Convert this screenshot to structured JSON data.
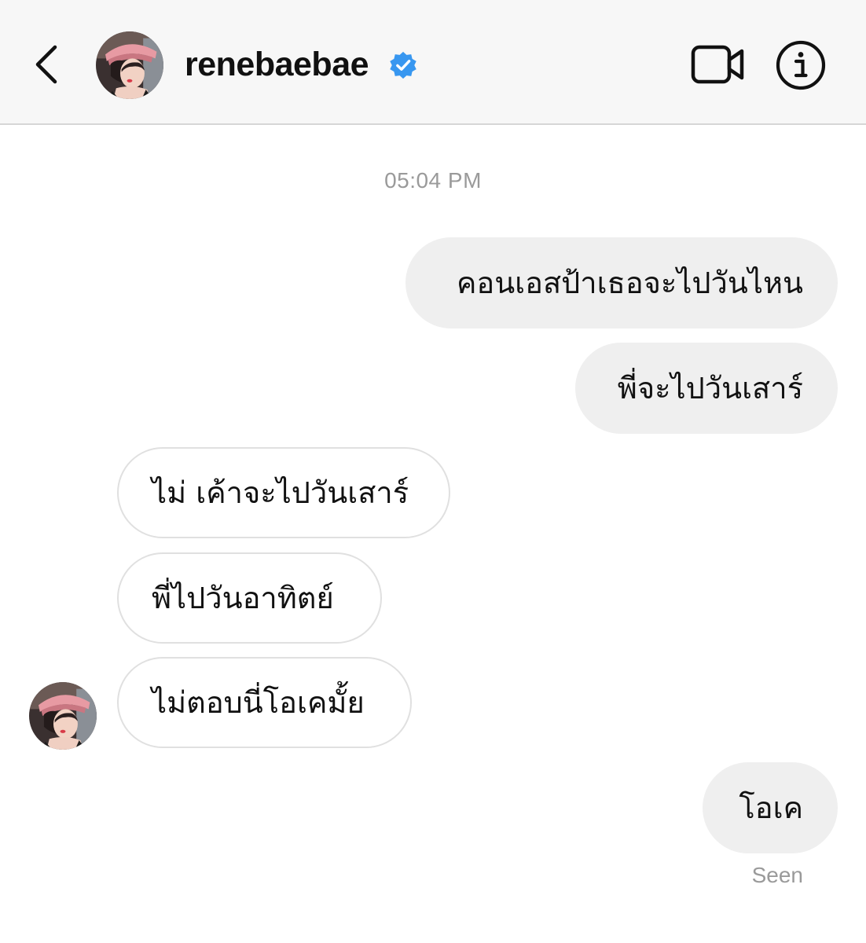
{
  "header": {
    "username": "renebaebae",
    "verified_color": "#3897f0",
    "icons": {
      "back": "chevron-left-icon",
      "verified": "verified-badge-icon",
      "video": "video-camera-icon",
      "info": "info-icon"
    }
  },
  "conversation": {
    "timestamp": "05:04 PM",
    "messages": [
      {
        "direction": "outgoing",
        "text": "คอนเอสป้าเธอจะไปวันไหน"
      },
      {
        "direction": "outgoing",
        "text": "พี่จะไปวันเสาร์"
      },
      {
        "direction": "incoming",
        "text": "ไม่ เค้าจะไปวันเสาร์"
      },
      {
        "direction": "incoming",
        "text": "พี่ไปวันอาทิตย์"
      },
      {
        "direction": "incoming",
        "text": "ไม่ตอบนี่โอเคมั้ย"
      },
      {
        "direction": "outgoing",
        "text": "โอเค"
      }
    ],
    "seen_label": "Seen"
  },
  "colors": {
    "header_bg": "#f7f7f7",
    "outgoing_bubble": "#efefef",
    "incoming_border": "#e0e0e0",
    "meta_text": "#9a9a9a"
  }
}
